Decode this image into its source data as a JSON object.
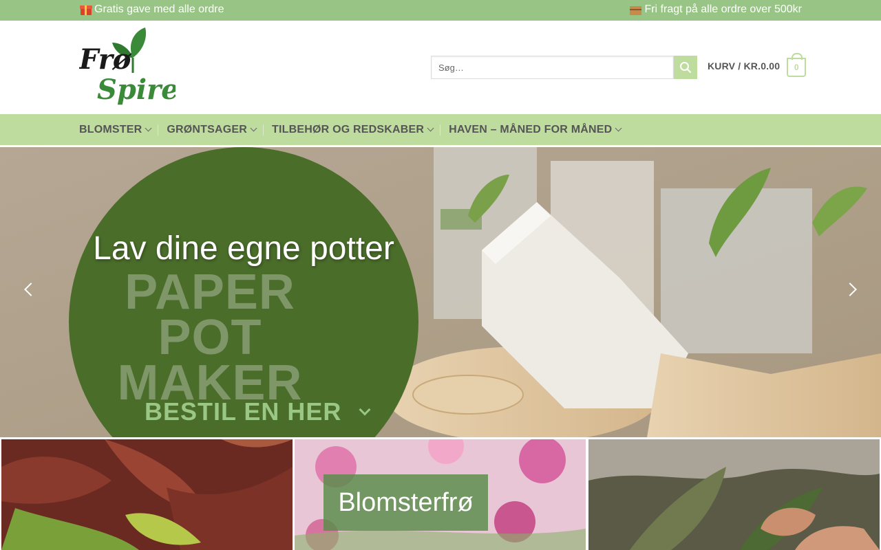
{
  "topbar": {
    "left_icon": "gift-icon",
    "left_text": "Gratis gave med alle ordre",
    "right_icon": "package-icon",
    "right_text": "Fri fragt på alle ordre over 500kr"
  },
  "header": {
    "logo_alt": "Frø Spiren",
    "search": {
      "placeholder": "Søg…"
    },
    "cart": {
      "label": "KURV / KR.0.00",
      "count": "0"
    }
  },
  "nav": {
    "items": [
      {
        "label": "BLOMSTER"
      },
      {
        "label": "GRØNTSAGER"
      },
      {
        "label": "TILBEHØR OG REDSKABER"
      },
      {
        "label": "HAVEN – MÅNED FOR MÅNED"
      }
    ]
  },
  "hero": {
    "line1": "Lav dine egne potter",
    "big_line1": "PAPER POT",
    "big_line2": "MAKER",
    "cta": "BESTIL EN HER"
  },
  "tiles": [
    {
      "label": ""
    },
    {
      "label": "Blomsterfrø"
    },
    {
      "label": ""
    }
  ],
  "colors": {
    "topbar": "#98c585",
    "nav": "#bfdc9f",
    "circle": "#4a6d2a",
    "accent": "#9ac785"
  }
}
